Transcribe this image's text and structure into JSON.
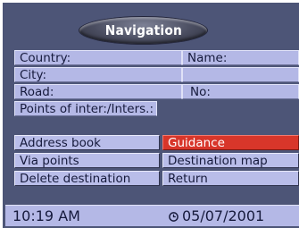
{
  "header": {
    "title": "Navigation"
  },
  "address": {
    "country_label": "Country:",
    "name_label": "Name:",
    "city_label": "City:",
    "road_label": "Road:",
    "no_label": "No:",
    "poi_label": "Points of inter:/Inters.:"
  },
  "menu": {
    "address_book": "Address book",
    "guidance": "Guidance",
    "via_points": "Via points",
    "destination_map": "Destination map",
    "delete_destination": "Delete destination",
    "return": "Return"
  },
  "status": {
    "time": "10:19 AM",
    "date": "05/07/2001"
  },
  "colors": {
    "screen_background": "#4d5577",
    "field": "#b4b8e6",
    "active_button": "#d8362a",
    "text": "#161a3c"
  },
  "icons": {
    "date": "clock-icon"
  }
}
